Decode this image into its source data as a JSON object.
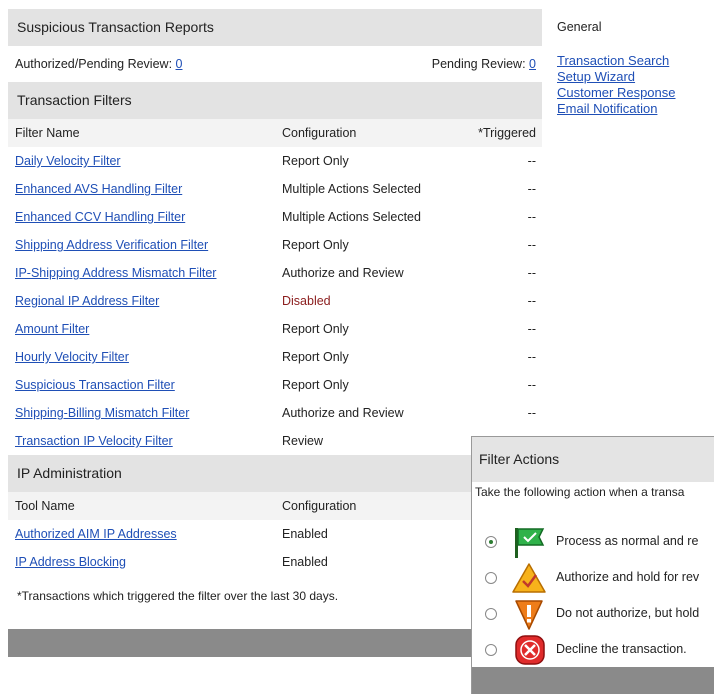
{
  "reports": {
    "title": "Suspicious Transaction Reports",
    "authorized_label": "Authorized/Pending Review:",
    "authorized_count": "0",
    "pending_label": "Pending Review:",
    "pending_count": "0"
  },
  "filters": {
    "title": "Transaction Filters",
    "columns": [
      "Filter Name",
      "Configuration",
      "*Triggered"
    ],
    "rows": [
      {
        "name": "Daily Velocity Filter",
        "config": "Report Only",
        "triggered": "--"
      },
      {
        "name": "Enhanced AVS Handling Filter",
        "config": "Multiple Actions Selected",
        "triggered": "--"
      },
      {
        "name": "Enhanced CCV Handling Filter",
        "config": "Multiple Actions Selected",
        "triggered": "--"
      },
      {
        "name": "Shipping Address Verification Filter",
        "config": "Report Only",
        "triggered": "--"
      },
      {
        "name": "IP-Shipping Address Mismatch Filter",
        "config": "Authorize and Review",
        "triggered": "--"
      },
      {
        "name": "Regional IP Address Filter",
        "config": "Disabled",
        "triggered": "--"
      },
      {
        "name": "Amount Filter",
        "config": "Report Only",
        "triggered": "--"
      },
      {
        "name": "Hourly Velocity Filter",
        "config": "Report Only",
        "triggered": "--"
      },
      {
        "name": "Suspicious Transaction Filter",
        "config": "Report Only",
        "triggered": "--"
      },
      {
        "name": "Shipping-Billing Mismatch Filter",
        "config": "Authorize and Review",
        "triggered": "--"
      },
      {
        "name": "Transaction IP Velocity Filter",
        "config": "Review",
        "triggered": ""
      }
    ]
  },
  "ip_admin": {
    "title": "IP Administration",
    "columns": [
      "Tool Name",
      "Configuration"
    ],
    "rows": [
      {
        "name": "Authorized AIM IP Addresses",
        "config": "Enabled"
      },
      {
        "name": "IP Address Blocking",
        "config": "Enabled"
      }
    ]
  },
  "footnote": "*Transactions which triggered the filter over the last 30 days.",
  "sidebar": {
    "heading": "General",
    "links": [
      "Transaction Search",
      "Setup Wizard",
      "Customer Response",
      "Email Notification"
    ]
  },
  "popup": {
    "title": "Filter Actions",
    "instruction": "Take the following action when a transa",
    "options": [
      {
        "label": "Process as normal and re",
        "icon": "green-flag-icon",
        "selected": true
      },
      {
        "label": "Authorize and hold for rev",
        "icon": "warning-triangle-icon",
        "selected": false
      },
      {
        "label": "Do not authorize, but hold",
        "icon": "exclamation-shield-icon",
        "selected": false
      },
      {
        "label": "Decline the transaction.",
        "icon": "decline-x-icon",
        "selected": false
      }
    ]
  },
  "colors": {
    "link": "#1f4fb6",
    "disabled": "#8b1d1d",
    "section_header": "#e3e3e3",
    "footer_bar": "#8a8a8a"
  }
}
